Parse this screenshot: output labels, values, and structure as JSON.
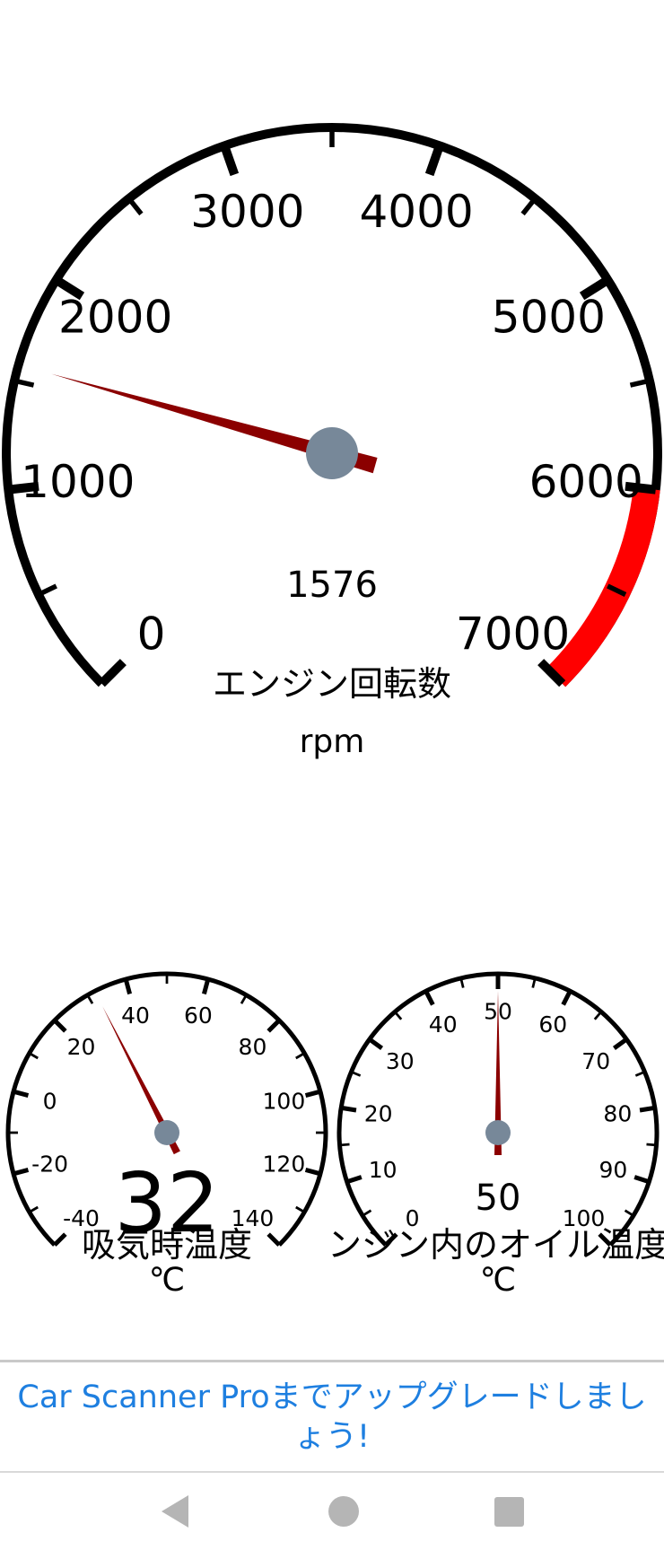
{
  "gauges": [
    {
      "id": "rpm",
      "title": "エンジン回転数",
      "unit": "rpm",
      "value": 1576,
      "value_label": "1576",
      "min": 0,
      "max": 7000,
      "major_step": 1000,
      "minor_step": 500,
      "red_from": 6000,
      "red_color": "#ff0000",
      "needle_color": "#8b0000",
      "hub_color": "#778899",
      "tick_labels": [
        "0",
        "1000",
        "2000",
        "3000",
        "4000",
        "5000",
        "6000",
        "7000"
      ]
    },
    {
      "id": "intake-temp",
      "title": "吸気時温度",
      "unit": "℃",
      "value": 32,
      "value_label": "32",
      "min": -40,
      "max": 140,
      "major_step": 20,
      "minor_step": 10,
      "needle_color": "#8b0000",
      "hub_color": "#778899",
      "tick_labels": [
        "-40",
        "-20",
        "0",
        "20",
        "40",
        "60",
        "80",
        "100",
        "120",
        "140"
      ]
    },
    {
      "id": "oil-temp",
      "title": "エンジン内のオイル温度",
      "unit": "℃",
      "value": 50,
      "value_label": "50",
      "min": 0,
      "max": 100,
      "major_step": 10,
      "minor_step": 5,
      "needle_color": "#8b0000",
      "hub_color": "#778899",
      "tick_labels": [
        "0",
        "10",
        "20",
        "30",
        "40",
        "50",
        "60",
        "70",
        "80",
        "90",
        "100"
      ]
    }
  ],
  "upgrade": {
    "label": "Car Scanner Proまでアップグレードしましょう!"
  },
  "nav": {
    "back_icon": "back-triangle-icon",
    "home_icon": "home-circle-icon",
    "recent_icon": "recent-square-icon"
  },
  "colors": {
    "accent": "#1e7fe0",
    "nav_icons": "#b5b5b5"
  }
}
